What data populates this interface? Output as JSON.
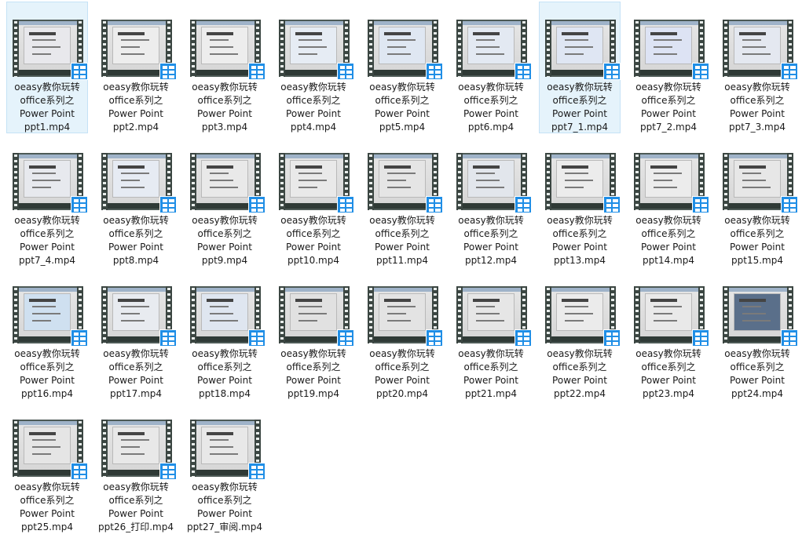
{
  "files": [
    {
      "line1": "oeasy教你玩转",
      "line2": "office系列之",
      "line3": "Power Point",
      "line4": "ppt1.mp4",
      "selected": true,
      "slide_color": "#e8e8ec"
    },
    {
      "line1": "oeasy教你玩转",
      "line2": "office系列之",
      "line3": "Power Point",
      "line4": "ppt2.mp4",
      "selected": false,
      "slide_color": "#ededed"
    },
    {
      "line1": "oeasy教你玩转",
      "line2": "office系列之",
      "line3": "Power Point",
      "line4": "ppt3.mp4",
      "selected": false,
      "slide_color": "#ededed"
    },
    {
      "line1": "oeasy教你玩转",
      "line2": "office系列之",
      "line3": "Power Point",
      "line4": "ppt4.mp4",
      "selected": false,
      "slide_color": "#e6ecf4"
    },
    {
      "line1": "oeasy教你玩转",
      "line2": "office系列之",
      "line3": "Power Point",
      "line4": "ppt5.mp4",
      "selected": false,
      "slide_color": "#dfe7f2"
    },
    {
      "line1": "oeasy教你玩转",
      "line2": "office系列之",
      "line3": "Power Point",
      "line4": "ppt6.mp4",
      "selected": false,
      "slide_color": "#e3e9f2"
    },
    {
      "line1": "oeasy教你玩转",
      "line2": "office系列之",
      "line3": "Power Point",
      "line4": "ppt7_1.mp4",
      "selected": true,
      "slide_color": "#dfe6f3"
    },
    {
      "line1": "oeasy教你玩转",
      "line2": "office系列之",
      "line3": "Power Point",
      "line4": "ppt7_2.mp4",
      "selected": false,
      "slide_color": "#dde3f4"
    },
    {
      "line1": "oeasy教你玩转",
      "line2": "office系列之",
      "line3": "Power Point",
      "line4": "ppt7_3.mp4",
      "selected": false,
      "slide_color": "#e4e8f0"
    },
    {
      "line1": "oeasy教你玩转",
      "line2": "office系列之",
      "line3": "Power Point",
      "line4": "ppt7_4.mp4",
      "selected": false,
      "slide_color": "#e7e9ee"
    },
    {
      "line1": "oeasy教你玩转",
      "line2": "office系列之",
      "line3": "Power Point",
      "line4": "ppt8.mp4",
      "selected": false,
      "slide_color": "#e6ebf3"
    },
    {
      "line1": "oeasy教你玩转",
      "line2": "office系列之",
      "line3": "Power Point",
      "line4": "ppt9.mp4",
      "selected": false,
      "slide_color": "#e9e9e9"
    },
    {
      "line1": "oeasy教你玩转",
      "line2": "office系列之",
      "line3": "Power Point",
      "line4": "ppt10.mp4",
      "selected": false,
      "slide_color": "#e9e9e9"
    },
    {
      "line1": "oeasy教你玩转",
      "line2": "office系列之",
      "line3": "Power Point",
      "line4": "ppt11.mp4",
      "selected": false,
      "slide_color": "#e5e5e5"
    },
    {
      "line1": "oeasy教你玩转",
      "line2": "office系列之",
      "line3": "Power Point",
      "line4": "ppt12.mp4",
      "selected": false,
      "slide_color": "#e2e6ec"
    },
    {
      "line1": "oeasy教你玩转",
      "line2": "office系列之",
      "line3": "Power Point",
      "line4": "ppt13.mp4",
      "selected": false,
      "slide_color": "#ececec"
    },
    {
      "line1": "oeasy教你玩转",
      "line2": "office系列之",
      "line3": "Power Point",
      "line4": "ppt14.mp4",
      "selected": false,
      "slide_color": "#ececec"
    },
    {
      "line1": "oeasy教你玩转",
      "line2": "office系列之",
      "line3": "Power Point",
      "line4": "ppt15.mp4",
      "selected": false,
      "slide_color": "#e7e7e7"
    },
    {
      "line1": "oeasy教你玩转",
      "line2": "office系列之",
      "line3": "Power Point",
      "line4": "ppt16.mp4",
      "selected": false,
      "slide_color": "#cfe0f0"
    },
    {
      "line1": "oeasy教你玩转",
      "line2": "office系列之",
      "line3": "Power Point",
      "line4": "ppt17.mp4",
      "selected": false,
      "slide_color": "#e8ebf0"
    },
    {
      "line1": "oeasy教你玩转",
      "line2": "office系列之",
      "line3": "Power Point",
      "line4": "ppt18.mp4",
      "selected": false,
      "slide_color": "#dfe6f0"
    },
    {
      "line1": "oeasy教你玩转",
      "line2": "office系列之",
      "line3": "Power Point",
      "line4": "ppt19.mp4",
      "selected": false,
      "slide_color": "#e1e1e1"
    },
    {
      "line1": "oeasy教你玩转",
      "line2": "office系列之",
      "line3": "Power Point",
      "line4": "ppt20.mp4",
      "selected": false,
      "slide_color": "#e3e3e3"
    },
    {
      "line1": "oeasy教你玩转",
      "line2": "office系列之",
      "line3": "Power Point",
      "line4": "ppt21.mp4",
      "selected": false,
      "slide_color": "#e6e6e6"
    },
    {
      "line1": "oeasy教你玩转",
      "line2": "office系列之",
      "line3": "Power Point",
      "line4": "ppt22.mp4",
      "selected": false,
      "slide_color": "#ebebeb"
    },
    {
      "line1": "oeasy教你玩转",
      "line2": "office系列之",
      "line3": "Power Point",
      "line4": "ppt23.mp4",
      "selected": false,
      "slide_color": "#e9e9e9"
    },
    {
      "line1": "oeasy教你玩转",
      "line2": "office系列之",
      "line3": "Power Point",
      "line4": "ppt24.mp4",
      "selected": false,
      "slide_color": "#5a6f8a"
    },
    {
      "line1": "oeasy教你玩转",
      "line2": "office系列之",
      "line3": "Power Point",
      "line4": "ppt25.mp4",
      "selected": false,
      "slide_color": "#e5e5e5"
    },
    {
      "line1": "oeasy教你玩转",
      "line2": "office系列之",
      "line3": "Power Point",
      "line4": "ppt26_打印.mp4",
      "selected": false,
      "slide_color": "#e8e8e8"
    },
    {
      "line1": "oeasy教你玩转",
      "line2": "office系列之",
      "line3": "Power Point",
      "line4": "ppt27_审阅.mp4",
      "selected": false,
      "slide_color": "#e8e8e8"
    }
  ]
}
